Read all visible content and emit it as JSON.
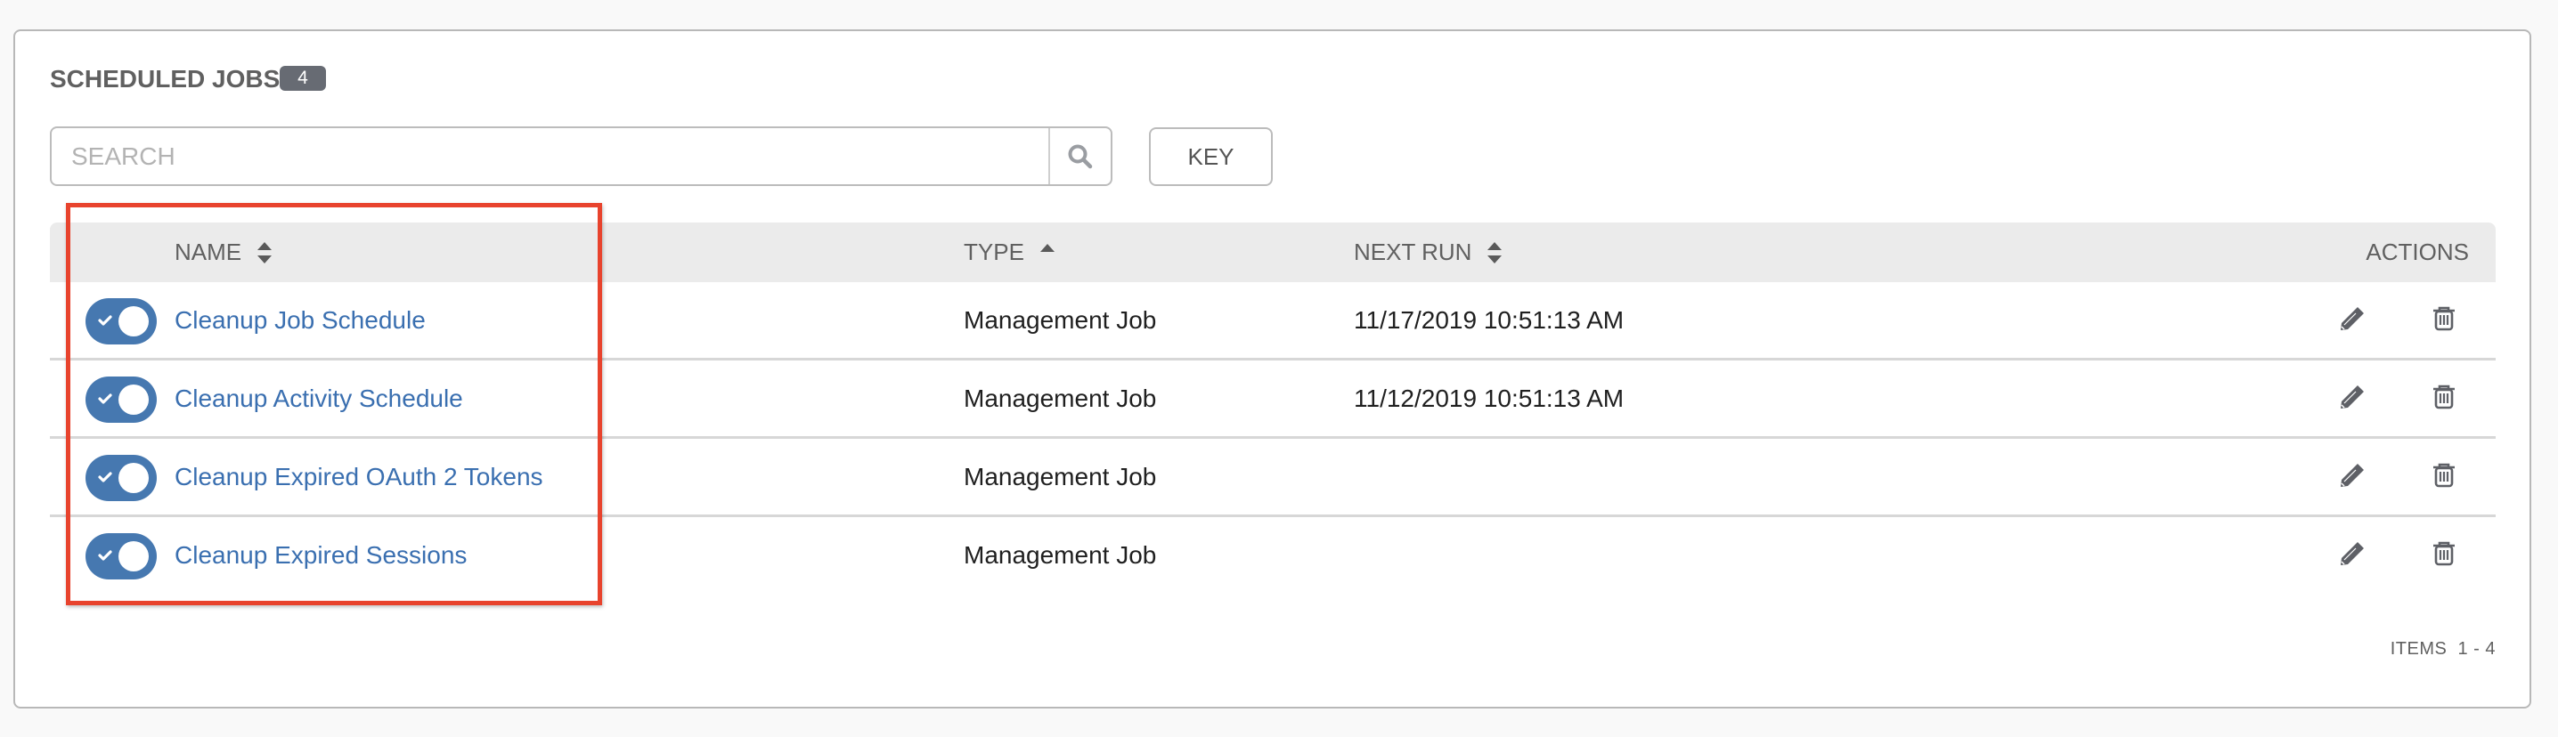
{
  "panel": {
    "title": "SCHEDULED JOBS",
    "count_badge": "4"
  },
  "search": {
    "placeholder": "SEARCH",
    "value": "",
    "icon": "search-icon"
  },
  "key_button": {
    "label": "KEY"
  },
  "table": {
    "columns": [
      {
        "label": "NAME",
        "sort": "both"
      },
      {
        "label": "TYPE",
        "sort": "ascending"
      },
      {
        "label": "NEXT RUN",
        "sort": "both"
      },
      {
        "label": "ACTIONS",
        "sort": "none"
      }
    ],
    "rows": [
      {
        "enabled": true,
        "name": "Cleanup Job Schedule",
        "type": "Management Job",
        "next_run": "11/17/2019 10:51:13 AM"
      },
      {
        "enabled": true,
        "name": "Cleanup Activity Schedule",
        "type": "Management Job",
        "next_run": "11/12/2019 10:51:13 AM"
      },
      {
        "enabled": true,
        "name": "Cleanup Expired OAuth 2 Tokens",
        "type": "Management Job",
        "next_run": ""
      },
      {
        "enabled": true,
        "name": "Cleanup Expired Sessions",
        "type": "Management Job",
        "next_run": ""
      }
    ],
    "row_actions": [
      "pencil-icon",
      "trash-icon"
    ]
  },
  "pagination": {
    "items_label": "ITEMS  1 - 4"
  },
  "colors": {
    "accent": "#4678b0",
    "link": "#3a6fb0",
    "badge": "#676b73",
    "header_bg": "#ebebeb",
    "highlight_box": "#e8432d"
  }
}
